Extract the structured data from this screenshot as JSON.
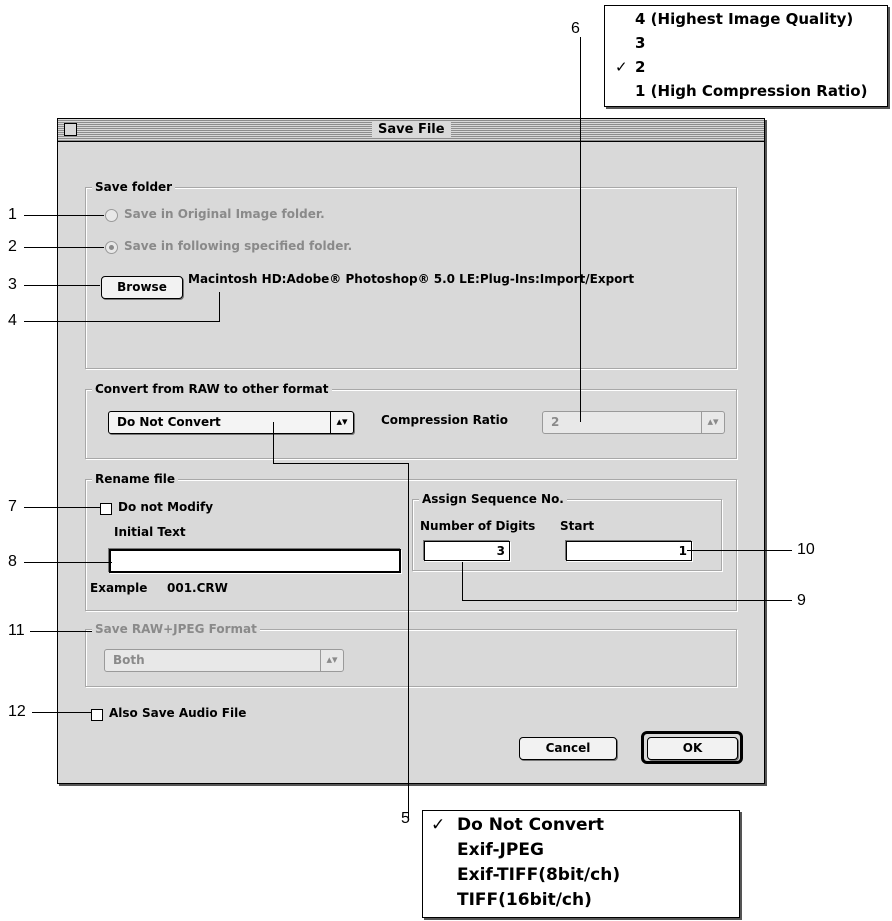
{
  "window": {
    "title": "Save File"
  },
  "save_folder": {
    "label": "Save folder",
    "option_original": "Save in Original Image folder.",
    "option_specified": "Save in following specified folder.",
    "browse_label": "Browse",
    "path": "Macintosh HD:Adobe® Photoshop® 5.0 LE:Plug-Ins:Import/Export"
  },
  "convert": {
    "label": "Convert from RAW to other format",
    "format_value": "Do Not Convert",
    "compression_label": "Compression Ratio",
    "compression_value": "2"
  },
  "rename": {
    "label": "Rename file",
    "do_not_modify": "Do not Modify",
    "initial_text_label": "Initial Text",
    "initial_text_value": "",
    "example_label": "Example",
    "example_value": "001.CRW"
  },
  "sequence": {
    "label": "Assign Sequence No.",
    "digits_label": "Number of Digits",
    "digits_value": "3",
    "start_label": "Start",
    "start_value": "1"
  },
  "raw_jpeg": {
    "label": "Save RAW+JPEG Format",
    "value": "Both"
  },
  "audio": {
    "label": "Also Save Audio File"
  },
  "buttons": {
    "cancel": "Cancel",
    "ok": "OK"
  },
  "compression_menu": {
    "items": [
      "4 (Highest Image Quality)",
      "3",
      "2",
      "1 (High Compression Ratio)"
    ],
    "checkmark": "✓",
    "selected": "2"
  },
  "format_menu": {
    "items": [
      "Do Not Convert",
      "Exif-JPEG",
      "Exif-TIFF(8bit/ch)",
      "TIFF(16bit/ch)"
    ],
    "checkmark": "✓",
    "selected": "Do Not Convert"
  },
  "callouts": [
    "1",
    "2",
    "3",
    "4",
    "5",
    "6",
    "7",
    "8",
    "9",
    "10",
    "11",
    "12"
  ]
}
